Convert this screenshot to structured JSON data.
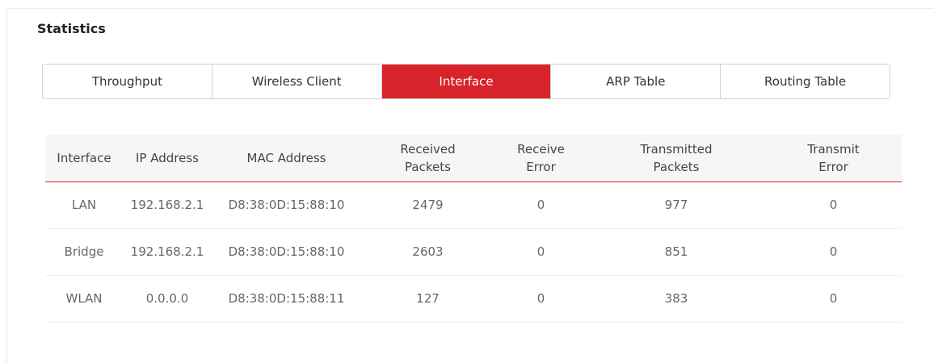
{
  "section_title": "Statistics",
  "tabs": [
    {
      "label": "Throughput",
      "active": false
    },
    {
      "label": "Wireless Client",
      "active": false
    },
    {
      "label": "Interface",
      "active": true
    },
    {
      "label": "ARP Table",
      "active": false
    },
    {
      "label": "Routing Table",
      "active": false
    }
  ],
  "colors": {
    "accent": "#d8232a",
    "header_bg": "#f6f6f6"
  },
  "table": {
    "headers": [
      [
        "Interface"
      ],
      [
        "IP Address"
      ],
      [
        "MAC Address"
      ],
      [
        "Received",
        "Packets"
      ],
      [
        "Receive",
        "Error"
      ],
      [
        "Transmitted",
        "Packets"
      ],
      [
        "Transmit",
        "Error"
      ]
    ],
    "rows": [
      [
        "LAN",
        "192.168.2.1",
        "D8:38:0D:15:88:10",
        "2479",
        "0",
        "977",
        "0"
      ],
      [
        "Bridge",
        "192.168.2.1",
        "D8:38:0D:15:88:10",
        "2603",
        "0",
        "851",
        "0"
      ],
      [
        "WLAN",
        "0.0.0.0",
        "D8:38:0D:15:88:11",
        "127",
        "0",
        "383",
        "0"
      ]
    ]
  }
}
